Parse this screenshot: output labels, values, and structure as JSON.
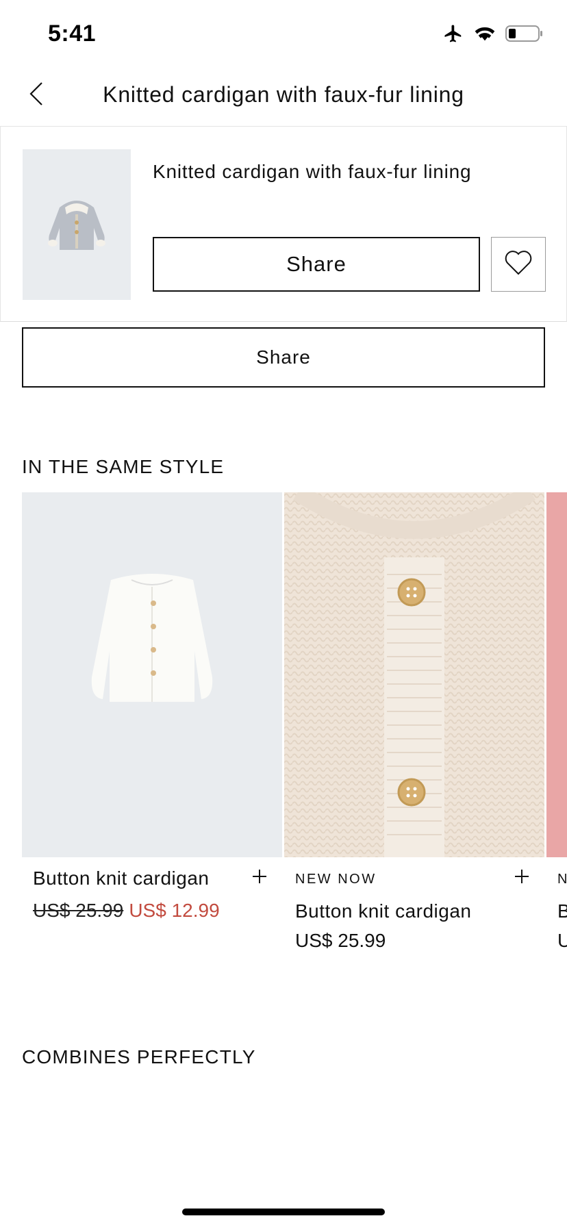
{
  "status_bar": {
    "time": "5:41"
  },
  "nav": {
    "title": "Knitted cardigan with faux-fur lining"
  },
  "product_card": {
    "name": "Knitted cardigan with faux-fur lining",
    "share_label": "Share"
  },
  "share_label": "Share",
  "same_style": {
    "title": "IN THE SAME STYLE",
    "items": [
      {
        "name": "Button knit cardigan",
        "old_price": "US$ 25.99",
        "sale_price": "US$ 12.99"
      },
      {
        "badge": "NEW NOW",
        "name": "Button knit cardigan",
        "price": "US$ 25.99"
      },
      {
        "badge": "N",
        "name": "B",
        "price": "U"
      }
    ]
  },
  "combines": {
    "title": "COMBINES PERFECTLY"
  },
  "colors": {
    "sale": "#c24b3f",
    "text": "#111111",
    "image_bg": "#e9ecef"
  },
  "icons": {
    "back": "chevron-left-icon",
    "airplane": "airplane-icon",
    "wifi": "wifi-icon",
    "battery": "battery-icon",
    "heart": "heart-icon",
    "plus": "plus-icon"
  }
}
